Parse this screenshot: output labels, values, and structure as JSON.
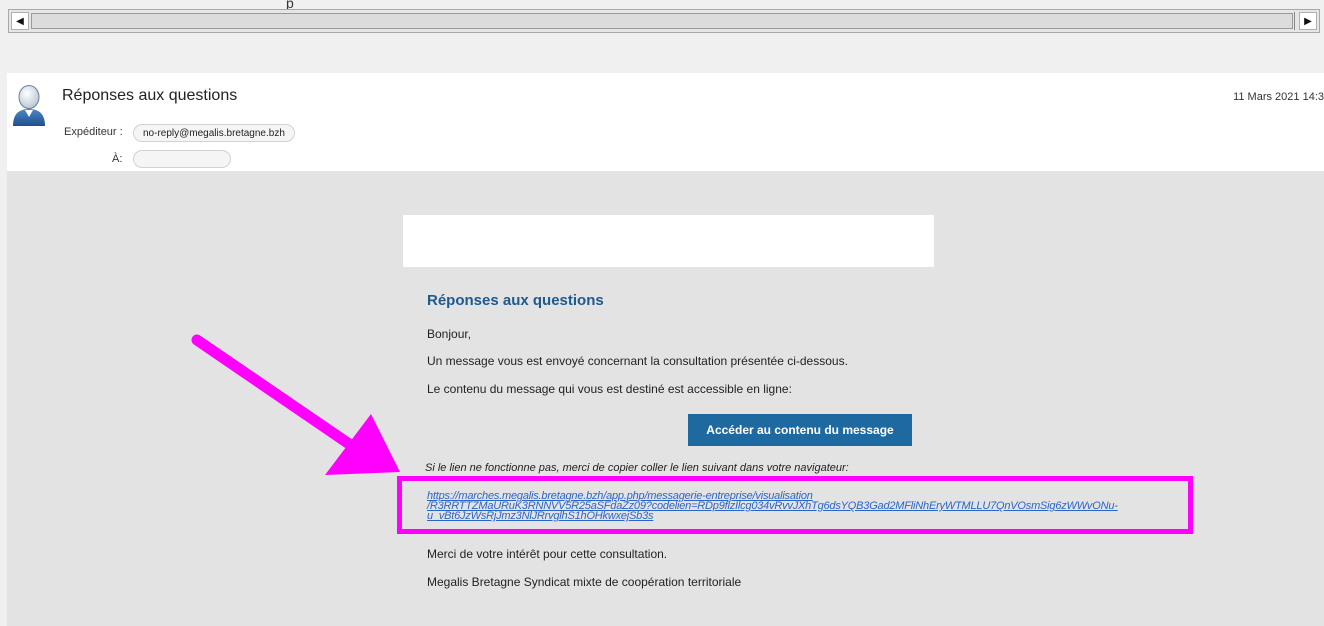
{
  "top_crop_text": "p",
  "scrollbar": {
    "left_arrow": "◀",
    "right_arrow": "▶"
  },
  "mail": {
    "subject": "Réponses aux questions",
    "date": "11 Mars 2021 14:3",
    "sender_label": "Expéditeur :",
    "sender": "no-reply@megalis.bretagne.bzh",
    "to_label": "À:",
    "to": ""
  },
  "body": {
    "heading": "Réponses aux questions",
    "greeting": "Bonjour,",
    "line1": "Un message vous est envoyé concernant la consultation présentée ci-dessous.",
    "line2": "Le contenu du message qui vous est destiné est accessible en ligne:",
    "cta_label": "Accéder au contenu du message",
    "hint": "Si le lien ne fonctionne pas, merci de copier coller le lien suivant dans votre navigateur:",
    "url_line1": "https://marches.megalis.bretagne.bzh/app.php/messagerie-entreprise/visualisation",
    "url_line2": "/R3RRTTZMaURuK3RNNVV5R25aSFdaZz09?codelien=RDp9flzIlcg034vRvvJXhTg6dsYQB3Gad2MFliNhEryWTMLLU7QnVOsmSig6zWWvONu-",
    "url_line3": "u_vBt6JzWsRjJmz3NlJRrvglhS1hOHkwxejSb3s",
    "thanks": "Merci de votre intérêt pour cette consultation.",
    "signature": "Megalis Bretagne Syndicat mixte de coopération territoriale"
  },
  "annotation_color": "#ff00ff",
  "accent_color": "#1e6aa0",
  "icons": [
    "scroll-left-arrow-icon",
    "scroll-right-arrow-icon",
    "user-avatar-icon",
    "annotation-arrow-icon"
  ]
}
